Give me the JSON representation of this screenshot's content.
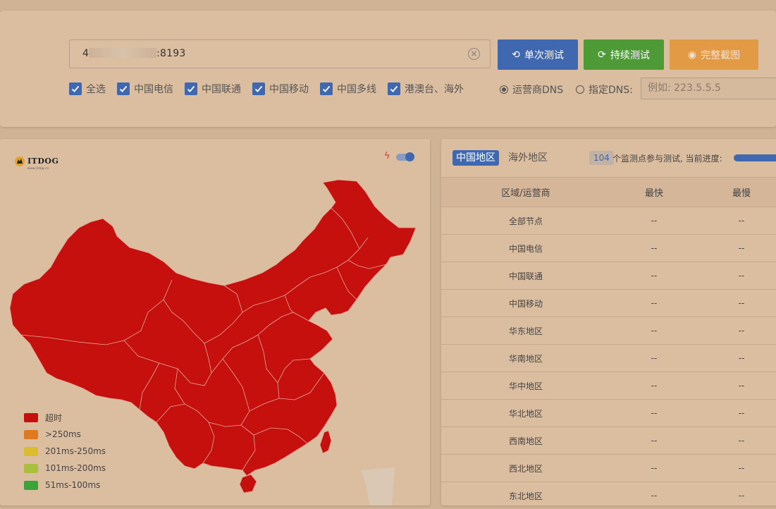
{
  "search": {
    "url_prefix": "4",
    "url_suffix": ":8193"
  },
  "buttons": {
    "single_test": "单次测试",
    "continuous_test": "持续测试",
    "screenshot": "完整截图"
  },
  "filters": [
    {
      "label": "全选",
      "checked": true
    },
    {
      "label": "中国电信",
      "checked": true
    },
    {
      "label": "中国联通",
      "checked": true
    },
    {
      "label": "中国移动",
      "checked": true
    },
    {
      "label": "中国多线",
      "checked": true
    },
    {
      "label": "港澳台、海外",
      "checked": true
    }
  ],
  "dns": {
    "option_isp": "运营商DNS",
    "option_custom": "指定DNS:",
    "selected": "isp",
    "placeholder": "例如: 223.5.5.5"
  },
  "map": {
    "logo": "ITDOG",
    "logo_sub": "www.itdog.cn",
    "fill_color": "#c5100e",
    "legend": [
      {
        "label": "超时",
        "color": "#c5100e"
      },
      {
        "label": ">250ms",
        "color": "#e07a22"
      },
      {
        "label": "201ms-250ms",
        "color": "#dbbc2f"
      },
      {
        "label": "101ms-200ms",
        "color": "#a8c03e"
      },
      {
        "label": "51ms-100ms",
        "color": "#3aa33a"
      }
    ]
  },
  "results": {
    "tab_cn": "中国地区",
    "tab_overseas": "海外地区",
    "node_count": "104",
    "progress_label": "个监测点参与测试, 当前进度:",
    "columns": {
      "region": "区域/运营商",
      "fastest": "最快",
      "slowest": "最慢"
    },
    "rows": [
      {
        "region": "全部节点",
        "fastest": "--",
        "slowest": "--"
      },
      {
        "region": "中国电信",
        "fastest": "--",
        "slowest": "--"
      },
      {
        "region": "中国联通",
        "fastest": "--",
        "slowest": "--"
      },
      {
        "region": "中国移动",
        "fastest": "--",
        "slowest": "--"
      },
      {
        "region": "华东地区",
        "fastest": "--",
        "slowest": "--"
      },
      {
        "region": "华南地区",
        "fastest": "--",
        "slowest": "--"
      },
      {
        "region": "华中地区",
        "fastest": "--",
        "slowest": "--"
      },
      {
        "region": "华北地区",
        "fastest": "--",
        "slowest": "--"
      },
      {
        "region": "西南地区",
        "fastest": "--",
        "slowest": "--"
      },
      {
        "region": "西北地区",
        "fastest": "--",
        "slowest": "--"
      },
      {
        "region": "东北地区",
        "fastest": "--",
        "slowest": "--"
      }
    ]
  }
}
